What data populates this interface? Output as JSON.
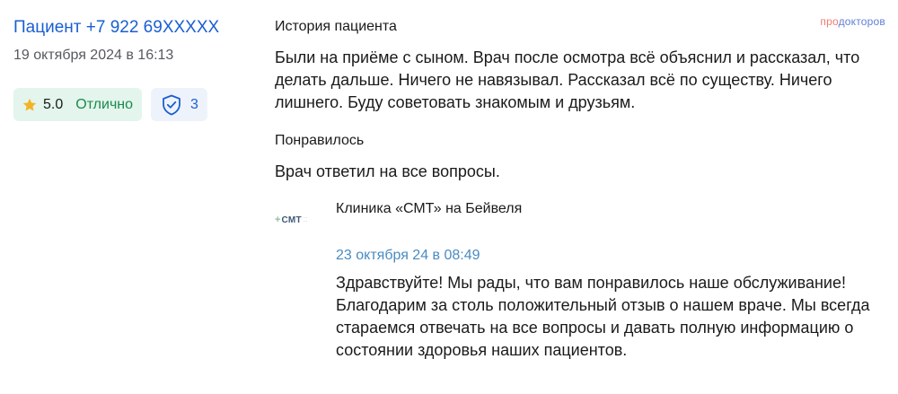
{
  "review": {
    "author": "Пациент +7 922 69XXXXX",
    "date": "19 октября 2024 в 16:13",
    "rating_value": "5.0",
    "rating_word": "Отлично",
    "verify_count": "3",
    "icons": [
      "star-icon",
      "shield-check-icon"
    ],
    "colors": {
      "author_link": "#1a5fd1",
      "rating_bg": "#e3f5ec",
      "rating_word": "#1a8a4f",
      "star": "#f5b324",
      "verify_bg": "#eef3fb",
      "shield": "#1a5fd1",
      "reply_date": "#4a8bc2"
    }
  },
  "brand": {
    "part1": "про",
    "part2": "докторов"
  },
  "sections": {
    "history_title": "История пациента",
    "history_text": "Были на приёме с сыном. Врач после осмотра всё объяснил и рассказал, что делать дальше. Ничего не навязывал. Рассказал всё по существу. Ничего лишнего. Буду советовать знакомым и друзьям.",
    "liked_title": "Понравилось",
    "liked_text": "Врач ответил на все вопросы."
  },
  "reply": {
    "logo_text": "СМТ",
    "clinic_name": "Клиника «СМТ» на Бейвеля",
    "date": "23 октября 24 в 08:49",
    "text": "Здравствуйте! Мы рады, что вам понравилось наше обслуживание! Благодарим за столь положительный отзыв о нашем враче. Мы всегда стараемся отвечать на все вопросы и давать полную информацию о состоянии здоровья наших пациентов."
  }
}
